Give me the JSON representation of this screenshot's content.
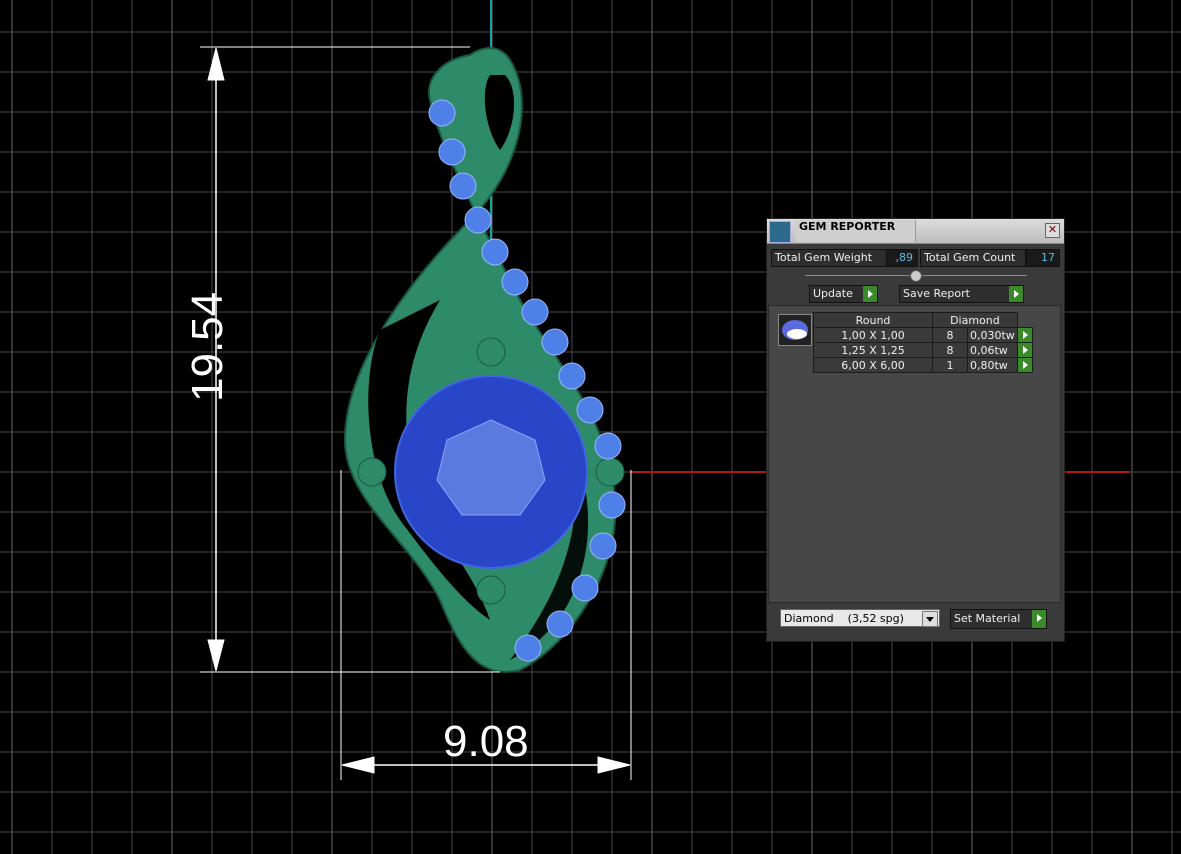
{
  "viewport": {
    "dimension_width": "9.08",
    "dimension_height": "19.54",
    "colors": {
      "background": "#000000",
      "grid": "#5a5a5a",
      "axis_red": "#b01818",
      "axis_teal": "#1aa0a0",
      "metal_green": "#2e8b6a",
      "center_stone": "#2a46c8",
      "accent_stones": "#4f80e8"
    }
  },
  "gem_reporter": {
    "title": "GEM REPORTER",
    "total_weight_label": "Total Gem Weight",
    "total_weight_value": ",89",
    "total_count_label": "Total Gem Count",
    "total_count_value": "17",
    "update_label": "Update",
    "save_report_label": "Save Report",
    "columns": [
      "Round",
      "Diamond"
    ],
    "rows": [
      {
        "size": "1,00 X 1,00",
        "count": "8",
        "weight": "0,030tw"
      },
      {
        "size": "1,25 X 1,25",
        "count": "8",
        "weight": "0,06tw"
      },
      {
        "size": "6,00 X 6,00",
        "count": "1",
        "weight": "0,80tw"
      }
    ],
    "material_value": "Diamond    (3,52 spg)",
    "set_material_label": "Set Material"
  }
}
